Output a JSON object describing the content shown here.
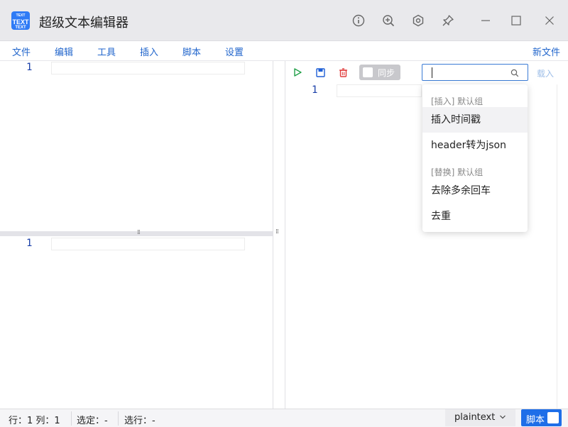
{
  "window": {
    "title": "超级文本编辑器",
    "logo_lines": [
      "TEXT",
      "TEXT",
      "TEXT"
    ],
    "controls": [
      "info-icon",
      "zoom-in-icon",
      "settings-icon",
      "pin-icon",
      "minimize-icon",
      "maximize-icon",
      "close-icon"
    ]
  },
  "menu": {
    "items": [
      "文件",
      "编辑",
      "工具",
      "插入",
      "脚本",
      "设置"
    ],
    "new_file": "新文件"
  },
  "editors": {
    "top_left_line": "1",
    "bottom_left_line": "1",
    "right_line": "1"
  },
  "toolbar": {
    "run_icon": "play-icon",
    "save_icon": "save-icon",
    "delete_icon": "trash-icon",
    "sync_label": "同步",
    "search_placeholder": "",
    "load_label": "载入",
    "accent": "#1e6ee8"
  },
  "dropdown": {
    "group1": "[插入] 默认组",
    "group1_items": [
      "插入时间戳",
      "header转为json"
    ],
    "group2": "[替换] 默认组",
    "group2_items": [
      "去除多余回车",
      "去重"
    ]
  },
  "status": {
    "position": "行：1 列：1",
    "selection": "选定：-",
    "selected_lines": "选行：-",
    "language": "plaintext",
    "script_label": "脚本"
  }
}
